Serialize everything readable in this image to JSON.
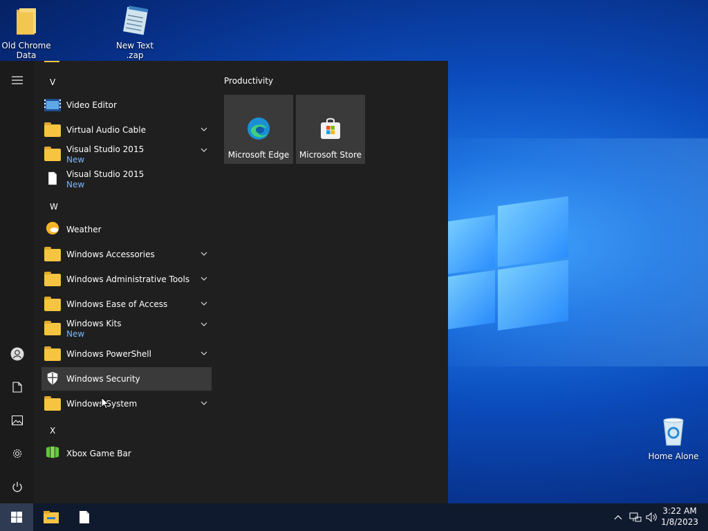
{
  "desktop": {
    "icons": [
      {
        "label": "Old Chrome Data"
      },
      {
        "label": "New Text .zap"
      },
      {
        "label": "Home Alone"
      }
    ]
  },
  "start_menu": {
    "sections": {
      "v": "V",
      "w": "W",
      "x": "X"
    },
    "apps": [
      {
        "name": "Video Editor"
      },
      {
        "name": "Virtual Audio Cable"
      },
      {
        "name": "Visual Studio 2015",
        "badge": "New"
      },
      {
        "name": "Visual Studio 2015",
        "badge": "New"
      },
      {
        "name": "Weather"
      },
      {
        "name": "Windows Accessories"
      },
      {
        "name": "Windows Administrative Tools"
      },
      {
        "name": "Windows Ease of Access"
      },
      {
        "name": "Windows Kits",
        "badge": "New"
      },
      {
        "name": "Windows PowerShell"
      },
      {
        "name": "Windows Security"
      },
      {
        "name": "Windows System"
      },
      {
        "name": "Xbox Game Bar"
      }
    ],
    "tile_group": "Productivity",
    "tiles": [
      {
        "name": "Microsoft Edge"
      },
      {
        "name": "Microsoft Store"
      }
    ]
  },
  "taskbar": {
    "time": "3:22 AM",
    "date": "1/8/2023"
  },
  "colors": {
    "start_bg": "#1f1f1f",
    "hover": "#3a3a3a",
    "new_badge": "#7ab8ff",
    "folder": "#f5c542"
  }
}
